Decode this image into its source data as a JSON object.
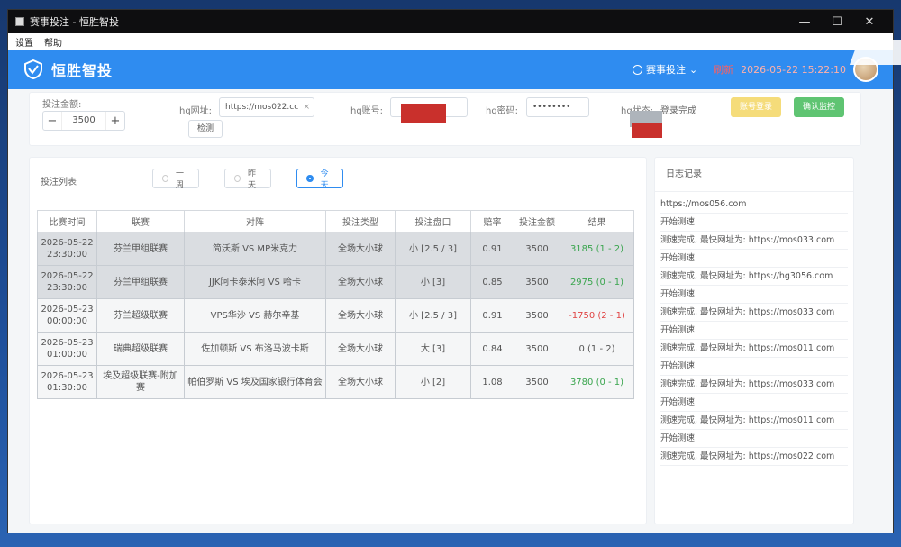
{
  "window": {
    "title": "赛事投注 - 恒胜智投",
    "minimize": "—",
    "maximize": "☐",
    "close": "✕"
  },
  "menu": {
    "settings": "设置",
    "help": "帮助"
  },
  "header": {
    "logo_text": "恒胜智投",
    "user_name": "赛事投注",
    "refresh_label": "刷新",
    "datetime": "2026-05-22 15:22:10"
  },
  "settings": {
    "amount_label": "投注金额:",
    "amount_value": "3500",
    "minus": "−",
    "plus": "+",
    "url_label": "hq网址:",
    "url_value": "https://mos022.cc",
    "check_label": "检测",
    "account_label": "hq账号:",
    "password_label": "hq密码:",
    "password_value": "••••••••",
    "status_prefix": "hq状态:",
    "status_value": "登录完成",
    "login_button": "账号登录",
    "start_button": "确认监控"
  },
  "list": {
    "title": "投注列表",
    "filters": [
      "一周",
      "昨天",
      "今天"
    ],
    "active_filter": 2,
    "columns": [
      "比赛时间",
      "联赛",
      "对阵",
      "投注类型",
      "投注盘口",
      "赔率",
      "投注金额",
      "结果"
    ],
    "rows": [
      {
        "time": "2026-05-22 23:30:00",
        "league": "芬兰甲组联赛",
        "match": "简沃斯 VS MP米克力",
        "type": "全场大小球",
        "handicap": "小 [2.5 / 3]",
        "odds": "0.91",
        "amount": "3500",
        "result": "3185 (1 - 2)",
        "result_class": "res-green"
      },
      {
        "time": "2026-05-22 23:30:00",
        "league": "芬兰甲组联赛",
        "match": "JJK阿卡泰米阿 VS 哈卡",
        "type": "全场大小球",
        "handicap": "小 [3]",
        "odds": "0.85",
        "amount": "3500",
        "result": "2975 (0 - 1)",
        "result_class": "res-green"
      },
      {
        "time": "2026-05-23 00:00:00",
        "league": "芬兰超级联赛",
        "match": "VPS华沙 VS 赫尔辛基",
        "type": "全场大小球",
        "handicap": "小 [2.5 / 3]",
        "odds": "0.91",
        "amount": "3500",
        "result": "-1750 (2 - 1)",
        "result_class": "res-red"
      },
      {
        "time": "2026-05-23 01:00:00",
        "league": "瑞典超级联赛",
        "match": "佐加顿斯 VS 布洛马波卡斯",
        "type": "全场大小球",
        "handicap": "大 [3]",
        "odds": "0.84",
        "amount": "3500",
        "result": "0 (1 - 2)",
        "result_class": ""
      },
      {
        "time": "2026-05-23 01:30:00",
        "league": "埃及超级联赛-附加赛",
        "match": "帕伯罗斯 VS 埃及国家银行体育会",
        "type": "全场大小球",
        "handicap": "小 [2]",
        "odds": "1.08",
        "amount": "3500",
        "result": "3780 (0 - 1)",
        "result_class": "res-green"
      }
    ]
  },
  "log": {
    "title": "日志记录",
    "lines": [
      "https://mos056.com",
      "开始测速",
      "测速完成, 最快网址为: https://mos033.com",
      "开始测速",
      "测速完成, 最快网址为: https://hg3056.com",
      "开始测速",
      "测速完成, 最快网址为: https://mos033.com",
      "开始测速",
      "测速完成, 最快网址为: https://mos011.com",
      "开始测速",
      "测速完成, 最快网址为: https://mos033.com",
      "开始测速",
      "测速完成, 最快网址为: https://mos011.com",
      "开始测速",
      "测速完成, 最快网址为: https://mos022.com"
    ]
  },
  "colors": {
    "header": "#2f8cf0",
    "green": "#3aa54e",
    "red": "#e04444",
    "yellow": "#f5dc7a"
  }
}
